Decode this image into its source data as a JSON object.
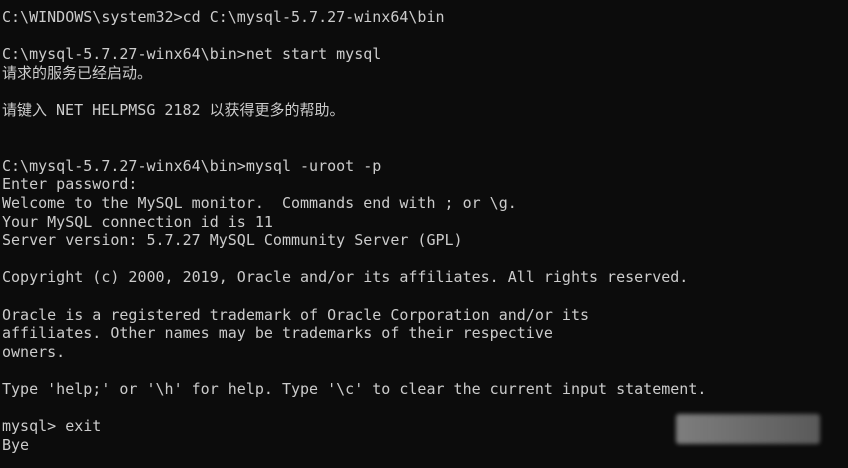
{
  "console": {
    "lines": [
      "C:\\WINDOWS\\system32>cd C:\\mysql-5.7.27-winx64\\bin",
      "",
      "C:\\mysql-5.7.27-winx64\\bin>net start mysql",
      "请求的服务已经启动。",
      "",
      "请键入 NET HELPMSG 2182 以获得更多的帮助。",
      "",
      "",
      "C:\\mysql-5.7.27-winx64\\bin>mysql -uroot -p",
      "Enter password:",
      "Welcome to the MySQL monitor.  Commands end with ; or \\g.",
      "Your MySQL connection id is 11",
      "Server version: 5.7.27 MySQL Community Server (GPL)",
      "",
      "Copyright (c) 2000, 2019, Oracle and/or its affiliates. All rights reserved.",
      "",
      "Oracle is a registered trademark of Oracle Corporation and/or its",
      "affiliates. Other names may be trademarks of their respective",
      "owners.",
      "",
      "Type 'help;' or '\\h' for help. Type '\\c' to clear the current input statement.",
      "",
      "mysql> exit",
      "Bye"
    ]
  }
}
